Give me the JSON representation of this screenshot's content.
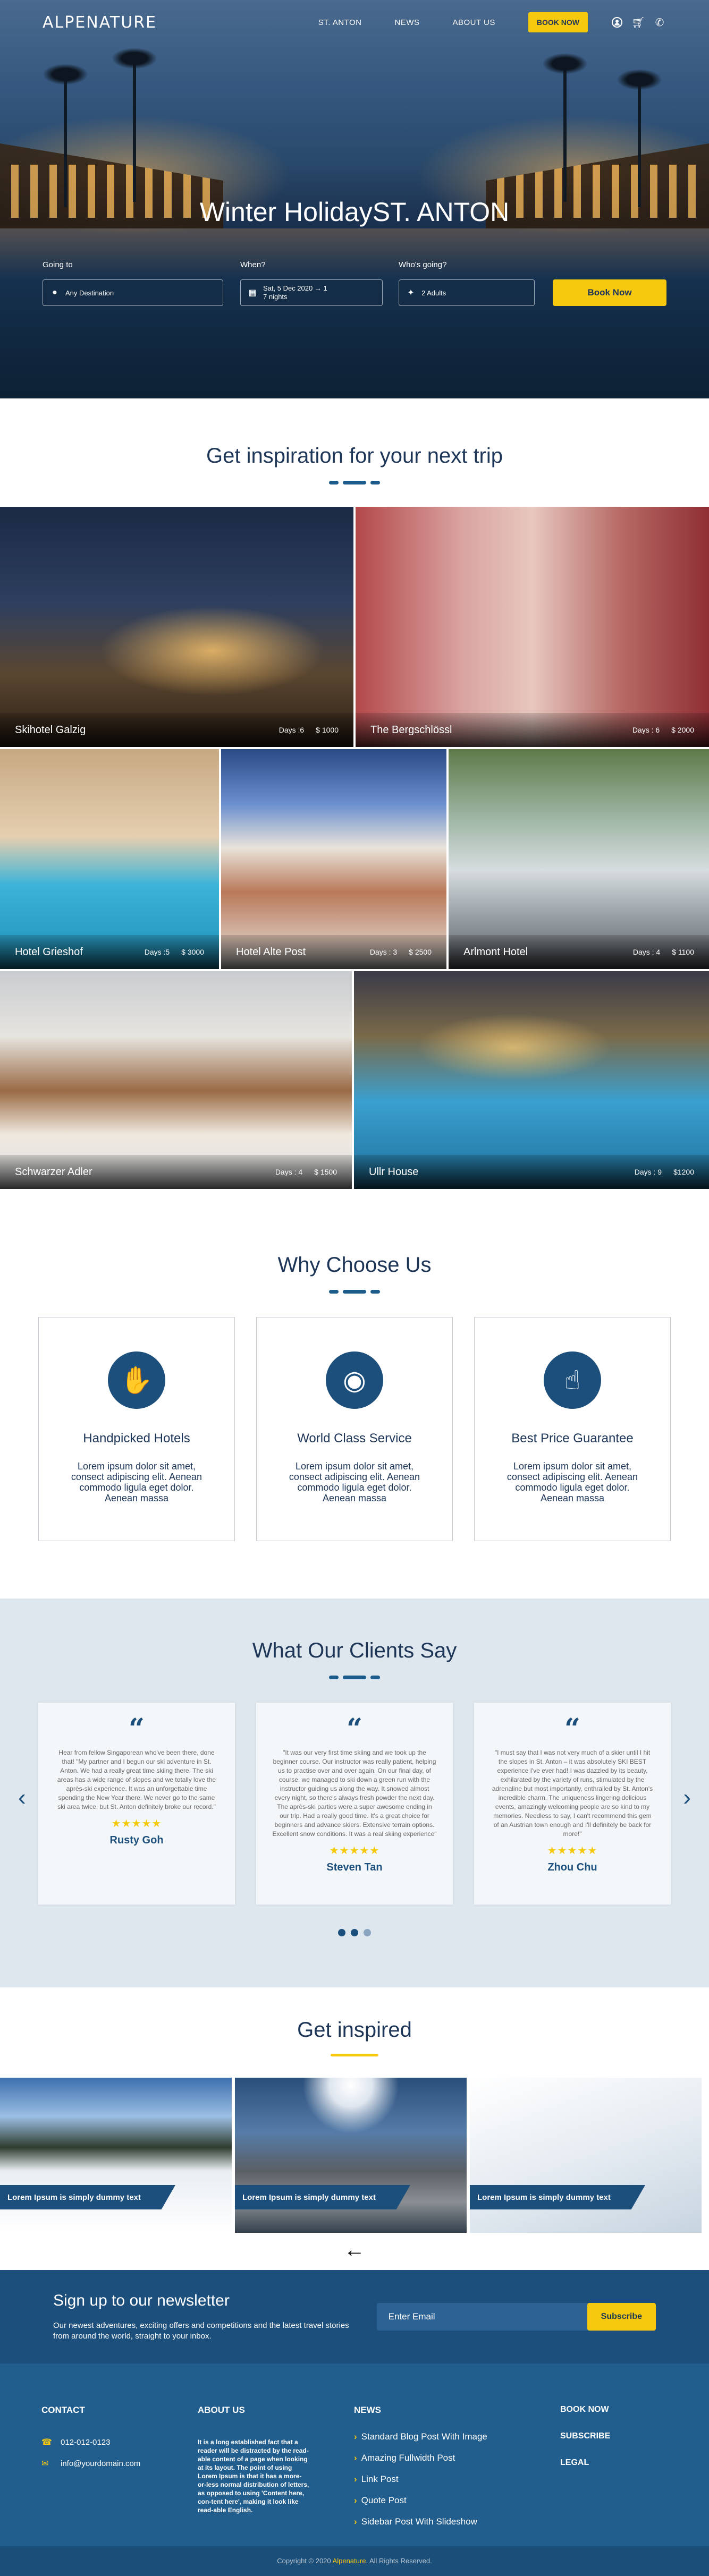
{
  "header": {
    "logo": "ALPENATURE",
    "nav": [
      "ST. ANTON",
      "NEWS",
      "ABOUT US"
    ],
    "book_label": "BOOK NOW",
    "icons": [
      "user-icon",
      "cart-icon",
      "phone-icon"
    ]
  },
  "hero": {
    "title": "Winter HolidayST. ANTON",
    "going_label": "Going to",
    "going_placeholder": "Any Destination",
    "when_label": "When?",
    "when_value": "Sat, 5 Dec 2020 → 1",
    "when_nights": "7 nights",
    "who_label": "Who's going?",
    "who_value": "2 Adults",
    "search_button": "Book Now"
  },
  "inspiration": {
    "title": "Get inspiration for your next trip",
    "hotels": [
      {
        "name": "Skihotel Galzig",
        "days": "Days :6",
        "price": "$ 1000"
      },
      {
        "name": "The Bergschlössl",
        "days": "Days : 6",
        "price": "$ 2000"
      },
      {
        "name": "Hotel Grieshof",
        "days": "Days :5",
        "price": "$ 3000"
      },
      {
        "name": "Hotel Alte Post",
        "days": "Days : 3",
        "price": "$ 2500"
      },
      {
        "name": "Arlmont Hotel",
        "days": "Days : 4",
        "price": "$ 1100"
      },
      {
        "name": "Schwarzer Adler",
        "days": "Days : 4",
        "price": "$ 1500"
      },
      {
        "name": "Ullr House",
        "days": "Days : 9",
        "price": "$1200"
      }
    ]
  },
  "why": {
    "title": "Why Choose Us",
    "cards": [
      {
        "title": "Handpicked Hotels",
        "text": "Lorem ipsum dolor sit amet, consect adipiscing elit. Aenean commodo ligula eget dolor. Aenean massa",
        "icon": "hand-badge-icon"
      },
      {
        "title": "World Class Service",
        "text": "Lorem ipsum dolor sit amet, consect adipiscing elit. Aenean commodo ligula eget dolor. Aenean massa",
        "icon": "globe-icon"
      },
      {
        "title": "Best Price Guarantee",
        "text": "Lorem ipsum dolor sit amet, consect adipiscing elit. Aenean commodo ligula eget dolor. Aenean massa",
        "icon": "thumbs-up-icon"
      }
    ]
  },
  "clients": {
    "title": "What Our Clients Say",
    "reviews": [
      {
        "text": "Hear from fellow Singaporean who've been there, done that! \"My partner and I begun our ski adventure in St. Anton. We had a really great time skiing there. The ski areas has a wide range of slopes and we totally love the après-ski experience. It was an unforgettable time spending the New Year there. We never go to the same ski area twice, but St. Anton definitely broke our record.\"",
        "stars": "★★★★★",
        "name": "Rusty Goh"
      },
      {
        "text": "\"It was our very first time skiing and we took up the beginner course. Our instructor was really patient, helping us to practise over and over again. On our final day, of course, we managed to ski down a green run with the instructor guiding us along the way. It snowed almost every night, so there's always fresh powder the next day. The après-ski parties were a super awesome ending in our trip. Had a really good time. It's a great choice for beginners and advance skiers. Extensive terrain options. Excellent snow conditions. It was a real skiing experience\"",
        "stars": "★★★★★",
        "name": "Steven Tan"
      },
      {
        "text": "\"I must say that I was not very much of a skier until I hit the slopes in St. Anton – it was absolutely SKI BEST experience I've ever had! I was dazzled by its beauty, exhilarated by the variety of runs, stimulated by the adrenaline but most importantly, enthralled by St. Anton's incredible charm. The uniqueness lingering delicious events, amazingly welcoming people are so kind to my memories. Needless to say, I can't recommend this gem of an Austrian town enough and I'll definitely be back for more!\"",
        "stars": "★★★★★",
        "name": "Zhou Chu"
      }
    ]
  },
  "inspired": {
    "title": "Get inspired",
    "posts": [
      "Lorem Ipsum is simply dummy text",
      "Lorem Ipsum is simply dummy text",
      "Lorem Ipsum is simply dummy text"
    ]
  },
  "newsletter": {
    "title": "Sign  up to our newsletter",
    "text": "Our newest adventures, exciting offers and competitions and the latest travel stories from around the world, straight to your inbox.",
    "placeholder": "Enter Email",
    "button": "Subscribe"
  },
  "footer": {
    "contact_head": "CONTACT",
    "phone": "012-012-0123",
    "email": "info@yourdomain.com",
    "about_head": "ABOUT US",
    "about_text": "It is a long established fact that a reader will be distracted by the read-able content of a page when looking at its layout. The point of using Lorem Ipsum is that it has a more-or-less normal distribution of letters, as opposed to using 'Content here, con-tent here', making it look like read-able English.",
    "news_head": "NEWS",
    "news_links": [
      "Standard Blog Post With Image",
      "Amazing Fullwidth Post",
      "Link Post",
      "Quote Post",
      "Sidebar Post With Slideshow"
    ],
    "right_links": [
      "BOOK NOW",
      "SUBSCRIBE",
      "LEGAL"
    ],
    "copyright_pre": "Copyright © 2020",
    "copyright_brand": "Alpenature",
    "copyright_post": ". All Rights Reserved."
  },
  "colors": {
    "navy": "#1d3557",
    "accent_blue": "#1d4f7c",
    "yellow": "#f6c90e",
    "light_bg": "#dfe7ee"
  }
}
